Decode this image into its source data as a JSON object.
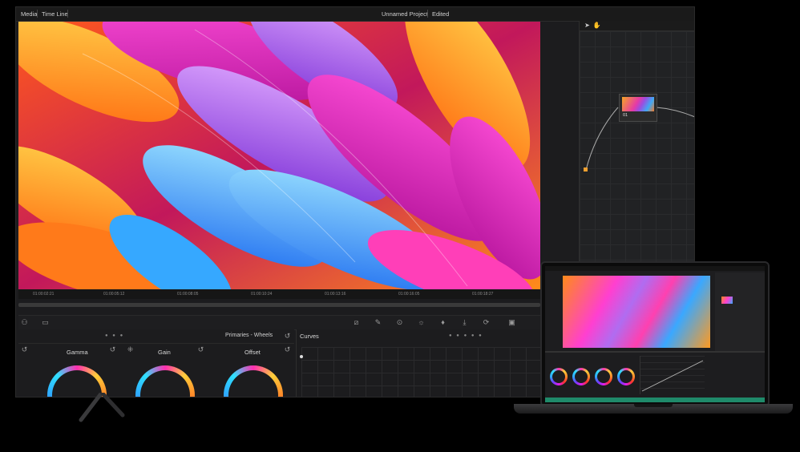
{
  "menubar": {
    "media": "Media",
    "timeline": "Time Line",
    "project_name": "Unnamed Project",
    "status": "Edited"
  },
  "node": {
    "label": "01"
  },
  "timecodes": [
    "01:00:02:21",
    "01:00:05:12",
    "01:00:08:05",
    "01:00:10:24",
    "01:00:13:16",
    "01:00:16:05",
    "01:00:18:27"
  ],
  "wheels": {
    "title": "Primaries - Wheels",
    "labels": [
      "Gamma",
      "Gain",
      "Offset"
    ]
  },
  "curves": {
    "title": "Curves"
  },
  "icons": [
    "pointer-icon",
    "hand-icon",
    "wand-icon",
    "eyedropper-icon",
    "target-icon",
    "sun-icon",
    "drop-icon",
    "download-icon",
    "refresh-icon",
    "picture-icon"
  ],
  "colors": {
    "accent": "#f0a030",
    "panel": "#1c1c1e",
    "background": "#000000"
  }
}
